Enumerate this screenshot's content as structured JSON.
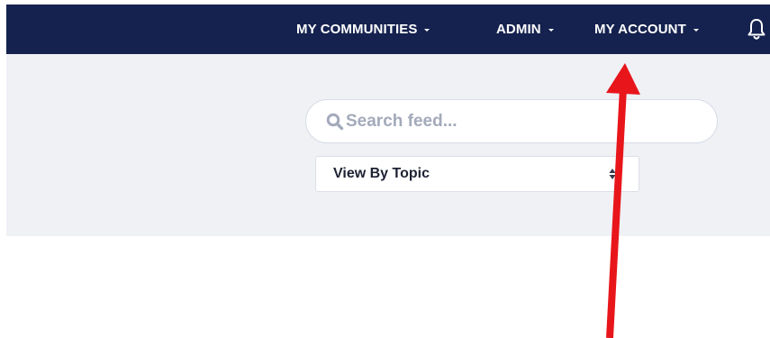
{
  "topnav": {
    "items": [
      {
        "label": "MY COMMUNITIES"
      },
      {
        "label": "ADMIN"
      },
      {
        "label": "MY ACCOUNT"
      }
    ],
    "background_color": "#15224f",
    "bell_icon": "bell-icon"
  },
  "feed": {
    "search": {
      "placeholder": "Search feed...",
      "value": "",
      "icon": "search-icon"
    },
    "topic_select": {
      "selected": "View By Topic",
      "icon": "sort-arrows-icon"
    },
    "background_color": "#f0f1f5"
  },
  "annotation": {
    "arrow_color": "#e8161b",
    "icon": "red-arrow-icon"
  }
}
